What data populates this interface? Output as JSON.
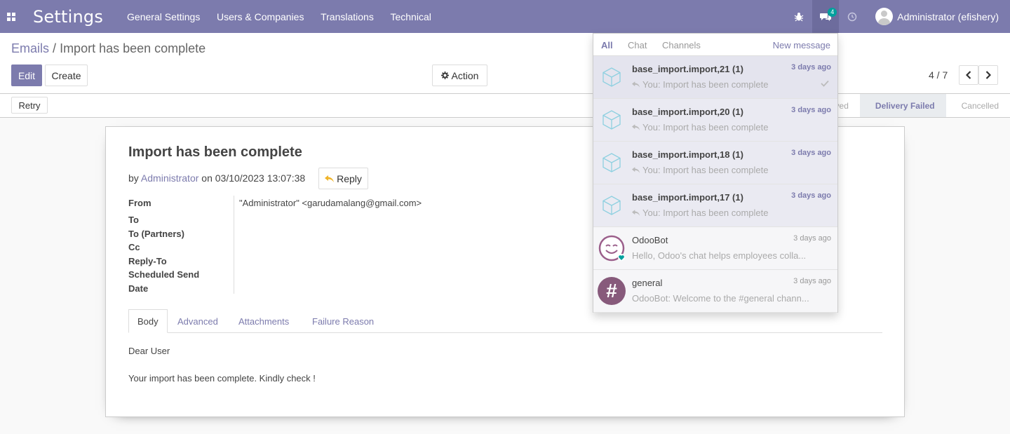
{
  "navbar": {
    "app_title": "Settings",
    "menu": [
      "General Settings",
      "Users & Companies",
      "Translations",
      "Technical"
    ],
    "messages_badge": "4",
    "user": "Administrator (efishery)"
  },
  "breadcrumb": {
    "parent": "Emails",
    "separator": "/",
    "current": "Import has been complete"
  },
  "buttons": {
    "edit": "Edit",
    "create": "Create",
    "action": "Action",
    "retry": "Retry",
    "reply": "Reply"
  },
  "pager": {
    "value": "4 / 7"
  },
  "stages": [
    "...eived",
    "Delivery Failed",
    "Cancelled"
  ],
  "mail": {
    "subject": "Import has been complete",
    "by": "by",
    "author": "Administrator",
    "on": "on 03/10/2023 13:07:38",
    "from_value": "\"Administrator\" <garudamalang@gmail.com>",
    "labels": [
      "From",
      "To",
      "To (Partners)",
      "Cc",
      "Reply-To",
      "Scheduled Send",
      "Date"
    ],
    "tabs": [
      "Body",
      "Advanced",
      "Attachments",
      "Failure Reason"
    ],
    "body_line1": "Dear User",
    "body_line2": "Your import has been complete. Kindly check !"
  },
  "dropdown": {
    "filters": [
      "All",
      "Chat",
      "Channels"
    ],
    "new_message": "New message",
    "items": [
      {
        "name": "base_import.import,21  (1)",
        "date": "3 days ago",
        "preview": "You: Import has been complete"
      },
      {
        "name": "base_import.import,20  (1)",
        "date": "3 days ago",
        "preview": "You: Import has been complete"
      },
      {
        "name": "base_import.import,18  (1)",
        "date": "3 days ago",
        "preview": "You: Import has been complete"
      },
      {
        "name": "base_import.import,17  (1)",
        "date": "3 days ago",
        "preview": "You: Import has been complete"
      },
      {
        "name": "OdooBot",
        "date": "3 days ago",
        "preview": "Hello, Odoo's chat helps employees colla..."
      },
      {
        "name": "general",
        "date": "3 days ago",
        "preview": "OdooBot: Welcome to the #general chann..."
      }
    ]
  }
}
